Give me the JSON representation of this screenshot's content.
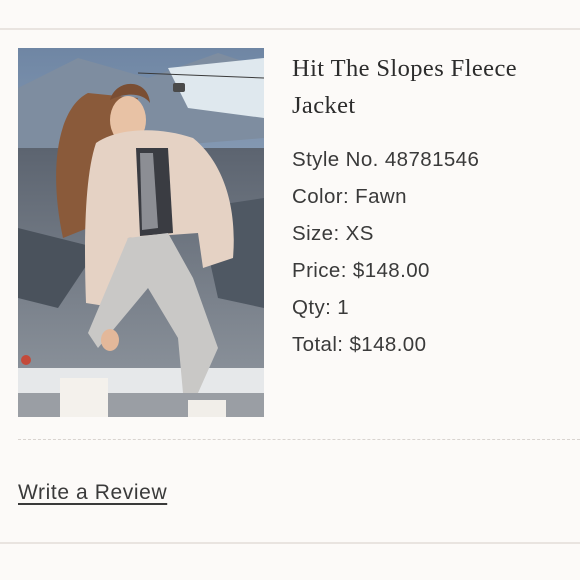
{
  "product": {
    "title": "Hit The Slopes Fleece Jacket",
    "style": "Style No. 48781546",
    "color": "Color: Fawn",
    "size": "Size: XS",
    "price": "Price: $148.00",
    "qty": "Qty: 1",
    "total": "Total: $148.00"
  },
  "actions": {
    "review_label": "Write a Review"
  }
}
